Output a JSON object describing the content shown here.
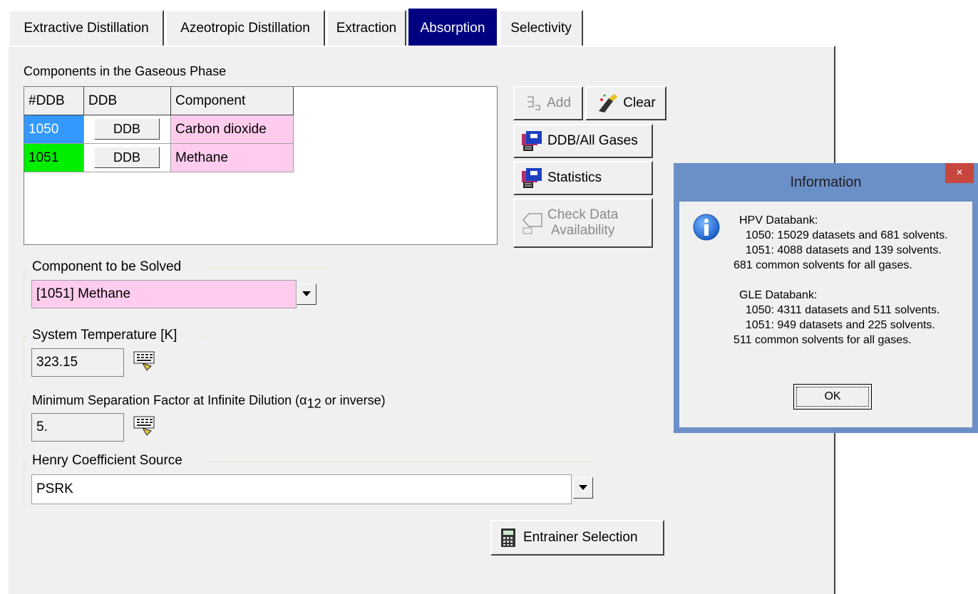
{
  "tabs": [
    {
      "label": "Extractive Distillation",
      "active": false
    },
    {
      "label": "Azeotropic Distillation",
      "active": false
    },
    {
      "label": "Extraction",
      "active": false
    },
    {
      "label": "Absorption",
      "active": true
    },
    {
      "label": "Selectivity",
      "active": false
    }
  ],
  "gas_components": {
    "title": "Components in the Gaseous Phase",
    "headers": [
      "#DDB",
      "DDB",
      "Component"
    ],
    "rows": [
      {
        "ddb_no": "1050",
        "ddb_button": "DDB",
        "component": "Carbon dioxide",
        "color": "#3399ff"
      },
      {
        "ddb_no": "1051",
        "ddb_button": "DDB",
        "component": "Methane",
        "color": "#00ee00"
      }
    ],
    "component_color": "#ffccee"
  },
  "buttons": {
    "add": "Add",
    "clear": "Clear",
    "ddb_all_gases": "DDB/All Gases",
    "statistics": "Statistics",
    "check_data_line1": "Check Data",
    "check_data_line2": "Availability",
    "entrainer_selection": "Entrainer Selection"
  },
  "component_to_solve": {
    "label": "Component to be Solved",
    "value": "[1051] Methane"
  },
  "system_temperature": {
    "label": "System Temperature [K]",
    "value": "323.15"
  },
  "separation_factor": {
    "label_prefix": "Minimum Separation Factor at Infinite Dilution (α",
    "label_sub": "12",
    "label_suffix": " or inverse)",
    "value": "5."
  },
  "henry_source": {
    "label": "Henry Coefficient Source",
    "value": "PSRK"
  },
  "dialog": {
    "title": "Information",
    "close": "×",
    "hpv_title": "HPV Databank:",
    "hpv_line1": "  1050: 15029 datasets and 681 solvents.",
    "hpv_line2": "  1051: 4088 datasets and 139 solvents.",
    "hpv_common": "681 common solvents for all gases.",
    "gle_title": "GLE Databank:",
    "gle_line1": "  1050: 4311 datasets and 511 solvents.",
    "gle_line2": "  1051: 949 datasets and 225 solvents.",
    "gle_common": "511 common solvents for all gases.",
    "ok": "OK"
  }
}
